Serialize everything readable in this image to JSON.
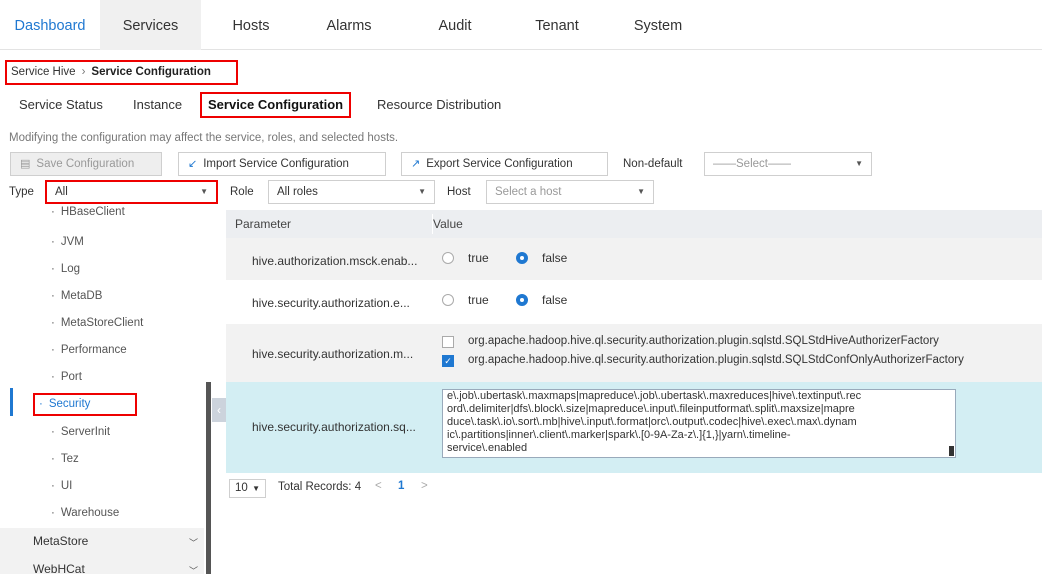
{
  "nav": {
    "tabs": [
      "Dashboard",
      "Services",
      "Hosts",
      "Alarms",
      "Audit",
      "Tenant",
      "System"
    ]
  },
  "breadcrumb": {
    "parent": "Service Hive",
    "separator": "›",
    "current": "Service Configuration"
  },
  "subtabs": [
    "Service Status",
    "Instance",
    "Service Configuration",
    "Resource Distribution"
  ],
  "hint": "Modifying the configuration may affect the service, roles, and selected hosts.",
  "toolbar": {
    "save": "Save Configuration",
    "import": "Import Service Configuration",
    "export": "Export Service Configuration",
    "nondefault_label": "Non-default",
    "nondefault_placeholder": "——Select——"
  },
  "filters": {
    "type_label": "Type",
    "type_value": "All",
    "role_label": "Role",
    "role_value": "All roles",
    "host_label": "Host",
    "host_placeholder": "Select a host"
  },
  "sidebar": {
    "items": [
      "HBaseClient",
      "JVM",
      "Log",
      "MetaDB",
      "MetaStoreClient",
      "Performance",
      "Port",
      "Security",
      "ServerInit",
      "Tez",
      "UI",
      "Warehouse"
    ],
    "sections": [
      "MetaStore",
      "WebHCat"
    ]
  },
  "table": {
    "headers": [
      "Parameter",
      "Value"
    ],
    "rows": [
      {
        "param": "hive.authorization.msck.enab...",
        "opt_true": "true",
        "opt_false": "false"
      },
      {
        "param": "hive.security.authorization.e...",
        "opt_true": "true",
        "opt_false": "false"
      },
      {
        "param": "hive.security.authorization.m...",
        "opt1": "org.apache.hadoop.hive.ql.security.authorization.plugin.sqlstd.SQLStdHiveAuthorizerFactory",
        "opt2": "org.apache.hadoop.hive.ql.security.authorization.plugin.sqlstd.SQLStdConfOnlyAuthorizerFactory"
      },
      {
        "param": "hive.security.authorization.sq...",
        "lines": [
          "e\\.job\\.ubertask\\.maxmaps|mapreduce\\.job\\.ubertask\\.maxreduces|hive\\.textinput\\.rec",
          "ord\\.delimiter|dfs\\.block\\.size|mapreduce\\.input\\.fileinputformat\\.split\\.maxsize|mapre",
          "duce\\.task\\.io\\.sort\\.mb|hive\\.input\\.format|orc\\.output\\.codec|hive\\.exec\\.max\\.dynam",
          "ic\\.partitions|inner\\.client\\.marker|spark\\.[0-9A-Za-z\\.]{1,}|yarn\\.timeline-",
          "service\\.enabled"
        ]
      }
    ]
  },
  "pager": {
    "page_size": "10",
    "total": "Total Records: 4",
    "prev": "<",
    "page": "1",
    "next": ">"
  },
  "colors": {
    "accent": "#1f78d1",
    "highlight": "#e00000",
    "selected_row": "#d3eef3"
  }
}
